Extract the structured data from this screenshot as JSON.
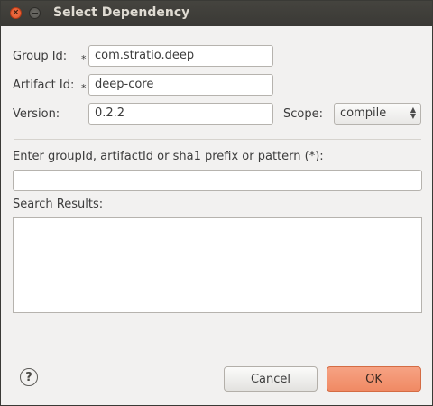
{
  "window": {
    "title": "Select Dependency"
  },
  "form": {
    "group_label": "Group Id:",
    "group_value": "com.stratio.deep",
    "artifact_label": "Artifact Id:",
    "artifact_value": "deep-core",
    "version_label": "Version:",
    "version_value": "0.2.2",
    "scope_label": "Scope:",
    "scope_value": "compile",
    "required_marker": "*"
  },
  "search": {
    "label": "Enter groupId, artifactId or sha1 prefix or pattern (*):",
    "value": "",
    "results_label": "Search Results:",
    "results": []
  },
  "buttons": {
    "help": "?",
    "cancel": "Cancel",
    "ok": "OK"
  },
  "icons": {
    "close": "close-icon",
    "minimize": "minimize-icon",
    "help": "help-icon"
  }
}
